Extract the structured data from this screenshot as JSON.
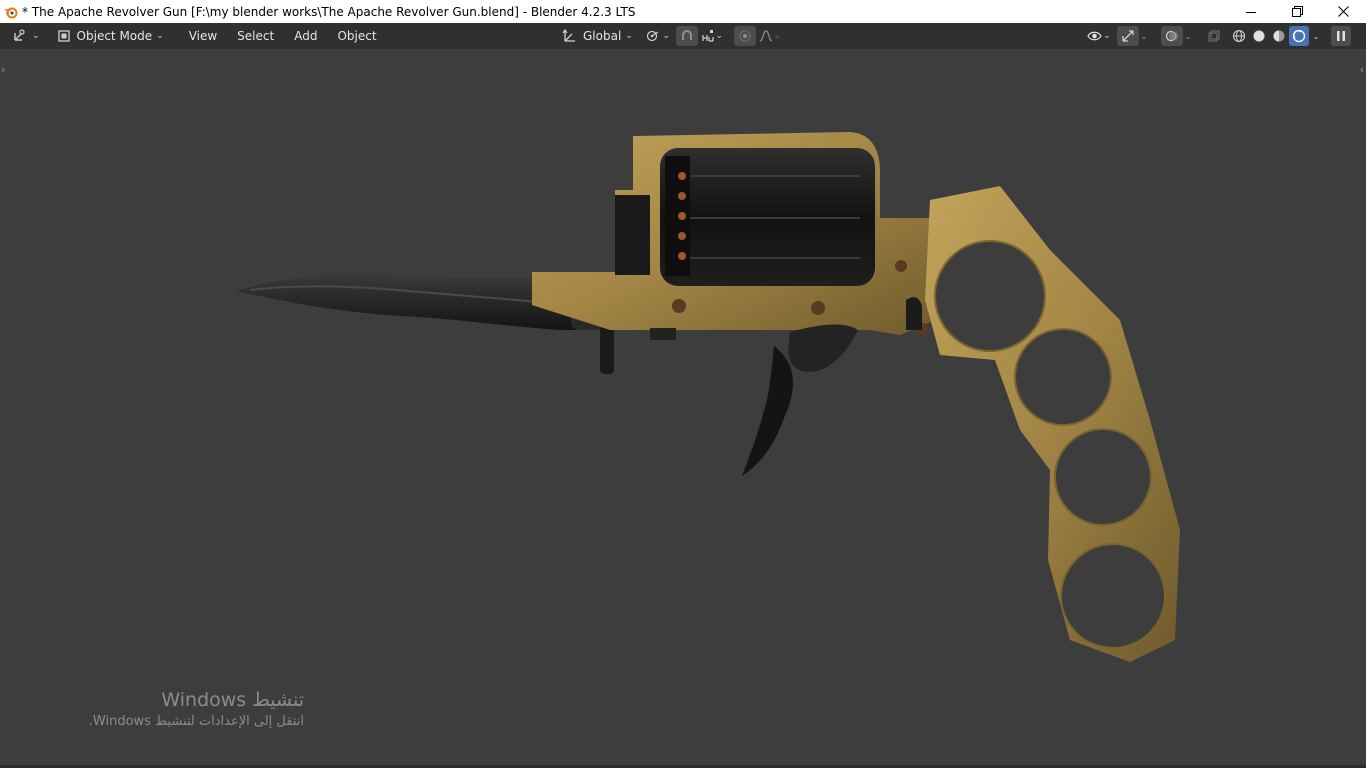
{
  "window": {
    "title": "* The Apache Revolver Gun [F:\\my blender works\\The Apache Revolver Gun.blend] - Blender 4.2.3 LTS"
  },
  "header": {
    "mode_label": "Object Mode",
    "menus": [
      "View",
      "Select",
      "Add",
      "Object"
    ],
    "transform_orientation": "Global"
  },
  "activation": {
    "title": "تنشيط Windows",
    "subtitle": "انتقل إلى الإعدادات لتنشيط Windows."
  },
  "colors": {
    "titlebar_bg": "#ffffff",
    "header_bg": "#303030",
    "viewport_bg": "#3d3d3d",
    "accent_blue": "#4772b3",
    "brass": "#a58a4a",
    "dark_metal": "#1c1c1c"
  },
  "icons": [
    "blender-icon",
    "minimize-icon",
    "restore-icon",
    "close-icon",
    "editor-type-icon",
    "object-mode-icon",
    "transform-orientation-icon",
    "pivot-icon",
    "snap-icon",
    "snap-target-icon",
    "proportional-edit-icon",
    "falloff-icon",
    "visibility-icon",
    "gizmo-icon",
    "overlay-icon",
    "xray-icon",
    "wireframe-shading-icon",
    "solid-shading-icon",
    "material-shading-icon",
    "rendered-shading-icon",
    "pause-icon"
  ]
}
